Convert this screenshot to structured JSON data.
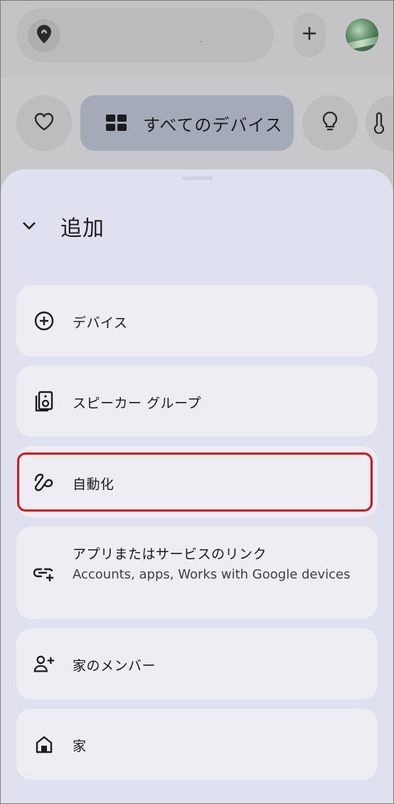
{
  "search": {
    "text": "."
  },
  "chips": {
    "all_devices": "すべてのデバイス"
  },
  "sheet": {
    "title": "追加",
    "items": [
      {
        "label": "デバイス"
      },
      {
        "label": "スピーカー グループ"
      },
      {
        "label": "自動化"
      },
      {
        "label": "アプリまたはサービスのリンク",
        "sub": "Accounts, apps, Works with Google devices"
      },
      {
        "label": "家のメンバー"
      },
      {
        "label": "家"
      }
    ]
  },
  "colors": {
    "highlight": "#e3101c",
    "sheet_bg": "#dfe2ee",
    "item_bg": "#eeedf2"
  }
}
